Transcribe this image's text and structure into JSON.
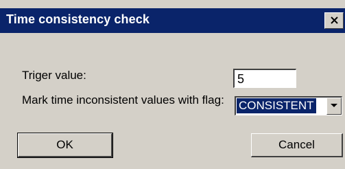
{
  "window": {
    "title": "Time consistency check",
    "close_glyph": "×",
    "close_icon": "close-icon"
  },
  "form": {
    "trigger_label": "Triger value:",
    "trigger_value": "5",
    "flag_label": "Mark time inconsistent values with flag:",
    "flag_value": "CONSISTENT",
    "flag_dropdown_icon": "chevron-down-icon"
  },
  "buttons": {
    "ok_label": "OK",
    "cancel_label": "Cancel"
  },
  "colors": {
    "titlebar": "#0a246a",
    "dialog_face": "#d4d0c8",
    "selection": "#0a246a"
  }
}
